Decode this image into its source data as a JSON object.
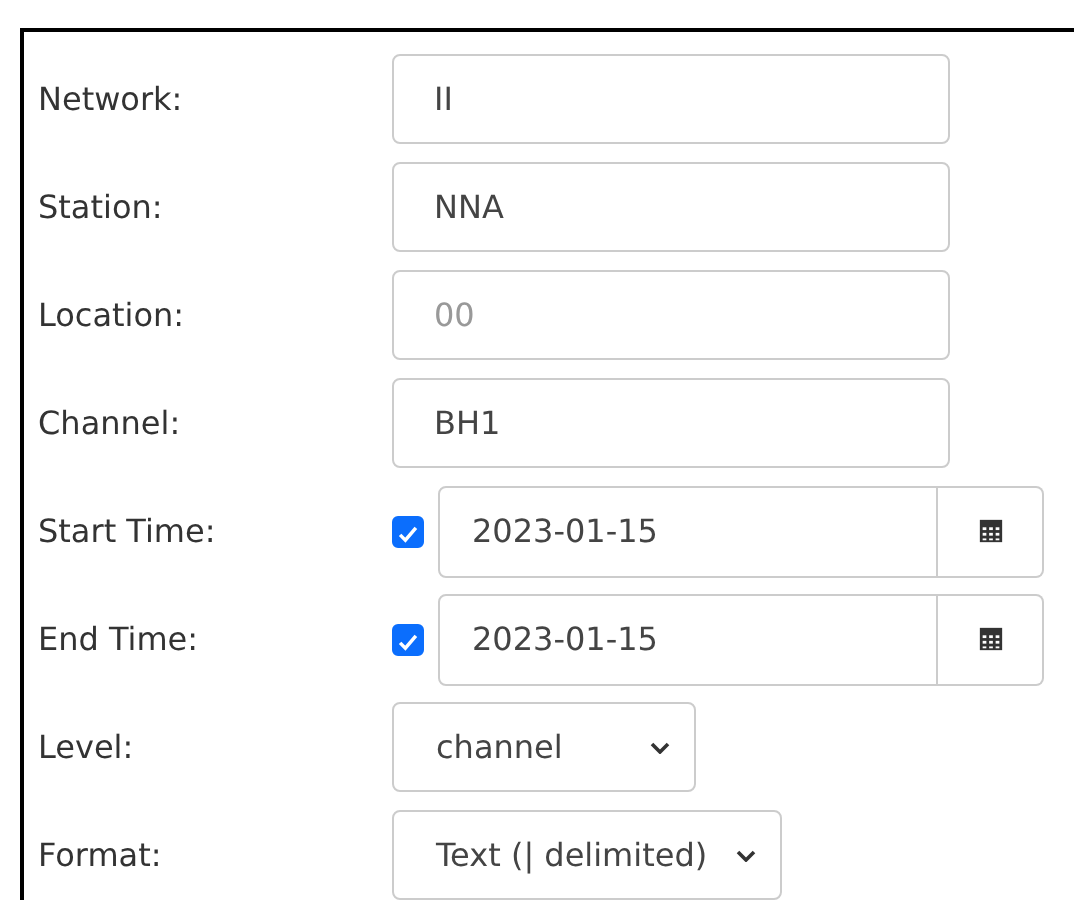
{
  "fields": [
    {
      "kind": "text",
      "label": "Network:",
      "value": "II"
    },
    {
      "kind": "text",
      "label": "Station:",
      "value": "NNA"
    },
    {
      "kind": "text",
      "label": "Location:",
      "placeholder": "00"
    },
    {
      "kind": "text",
      "label": "Channel:",
      "value": "BH1"
    },
    {
      "kind": "date",
      "label": "Start Time:",
      "checked": true,
      "value": "2023-01-15"
    },
    {
      "kind": "date",
      "label": "End Time:",
      "checked": true,
      "value": "2023-01-15"
    },
    {
      "kind": "select",
      "label": "Level:",
      "value": "channel"
    },
    {
      "kind": "select",
      "label": "Format:",
      "value": "Text (| delimited)"
    }
  ]
}
